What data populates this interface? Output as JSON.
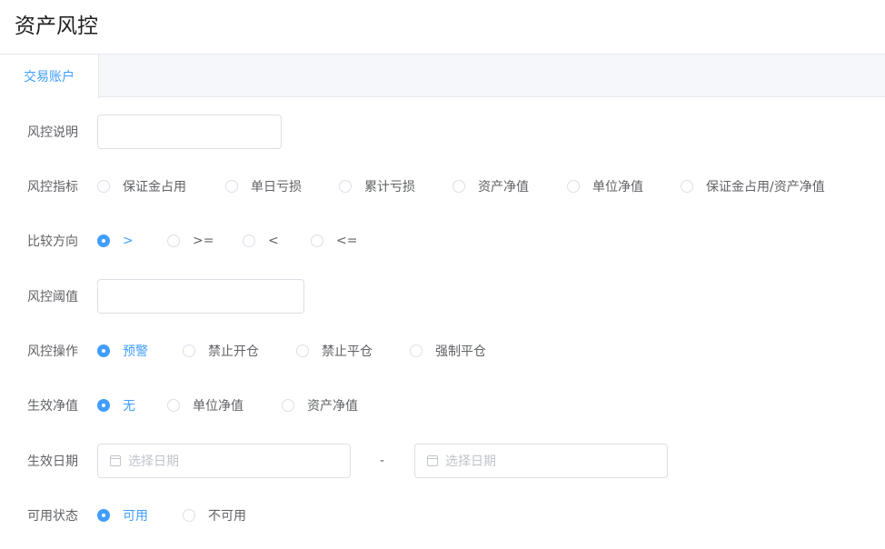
{
  "page": {
    "title": "资产风控"
  },
  "tabs": [
    {
      "label": "交易账户",
      "active": true
    }
  ],
  "form": {
    "description": {
      "label": "风控说明",
      "value": ""
    },
    "indicator": {
      "label": "风控指标",
      "options": [
        "保证金占用",
        "单日亏损",
        "累计亏损",
        "资产净值",
        "单位净值",
        "保证金占用/资产净值"
      ],
      "selected": null
    },
    "direction": {
      "label": "比较方向",
      "options": [
        ">",
        ">=",
        "<",
        "<="
      ],
      "selected": ">"
    },
    "threshold": {
      "label": "风控阈值",
      "value": ""
    },
    "action": {
      "label": "风控操作",
      "options": [
        "预警",
        "禁止开仓",
        "禁止平仓",
        "强制平仓"
      ],
      "selected": "预警"
    },
    "effective_nav": {
      "label": "生效净值",
      "options": [
        "无",
        "单位净值",
        "资产净值"
      ],
      "selected": "无"
    },
    "effective_date": {
      "label": "生效日期",
      "start_placeholder": "选择日期",
      "end_placeholder": "选择日期",
      "separator": "-"
    },
    "status": {
      "label": "可用状态",
      "options": [
        "可用",
        "不可用"
      ],
      "selected": "可用"
    }
  },
  "colors": {
    "primary": "#409eff",
    "text": "#606266",
    "border": "#dcdfe6",
    "placeholder": "#c0c4cc"
  }
}
